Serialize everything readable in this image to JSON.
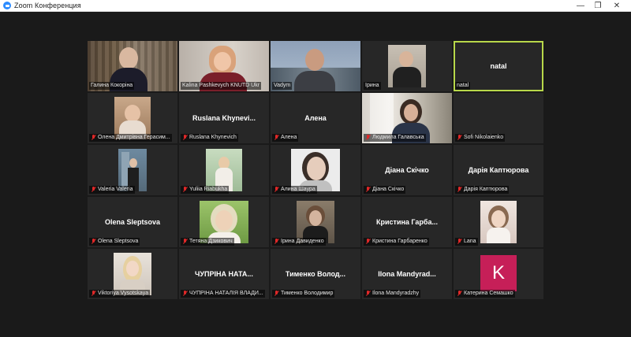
{
  "window": {
    "title": "Zoom Конференция"
  },
  "participants": [
    {
      "label": "Галина Кокоріна",
      "muted": false,
      "video": true
    },
    {
      "label": "Kalina Pashkevych KNUTD Ukr",
      "muted": false,
      "video": true
    },
    {
      "label": "Vadym",
      "muted": false,
      "video": true
    },
    {
      "label": "Ірина",
      "muted": false,
      "video": true
    },
    {
      "label": "natal",
      "center": "natal",
      "muted": false,
      "video": false,
      "active": true
    },
    {
      "label": "Олена Дмитрівна Герасим...",
      "muted": true,
      "video": true
    },
    {
      "label": "Ruslana Khynevich",
      "center": "Ruslana Khynevi...",
      "muted": true,
      "video": false
    },
    {
      "label": "Алена",
      "center": "Алена",
      "muted": true,
      "video": false
    },
    {
      "label": "Людмила Галавська",
      "muted": true,
      "video": true
    },
    {
      "label": "Sofi Nikolaienko",
      "muted": true,
      "video": false
    },
    {
      "label": "Valeria Valeria",
      "muted": true,
      "video": true
    },
    {
      "label": "Yuliia Riabukha",
      "muted": true,
      "video": true
    },
    {
      "label": "Алина Шаура",
      "muted": true,
      "video": true
    },
    {
      "label": "Діана Скічко",
      "center": "Діана Скічко",
      "muted": true,
      "video": false
    },
    {
      "label": "Дарія Каптюрова",
      "center": "Дарія Каптюрова",
      "muted": true,
      "video": false
    },
    {
      "label": "Olena Sleptsova",
      "center": "Olena Sleptsova",
      "muted": true,
      "video": false
    },
    {
      "label": "Тетяна Дзикович",
      "muted": true,
      "video": true
    },
    {
      "label": "Ірина Давиденко",
      "muted": true,
      "video": true
    },
    {
      "label": "Кристина Гарбаренко",
      "center": "Кристина Гарба...",
      "muted": true,
      "video": false
    },
    {
      "label": "Lana",
      "muted": true,
      "video": true
    },
    {
      "label": "Viktoriya Vysotskaya",
      "muted": true,
      "video": true
    },
    {
      "label": "ЧУПРІНА НАТАЛІЯ ВЛАДИ...",
      "center": "ЧУПРІНА НАТА...",
      "muted": true,
      "video": false
    },
    {
      "label": "Тименко Володимир",
      "center": "Тименко Волод...",
      "muted": true,
      "video": false
    },
    {
      "label": "Ilona Mandyradzhy",
      "center": "Ilona Mandyrad...",
      "muted": true,
      "video": false
    },
    {
      "label": "Катерина Семашко",
      "avatar": "K",
      "muted": true,
      "video": false
    }
  ],
  "colors": {
    "active_border": "#b8d84a",
    "avatar_bg": "#c61f58",
    "muted_icon": "#e02828"
  }
}
